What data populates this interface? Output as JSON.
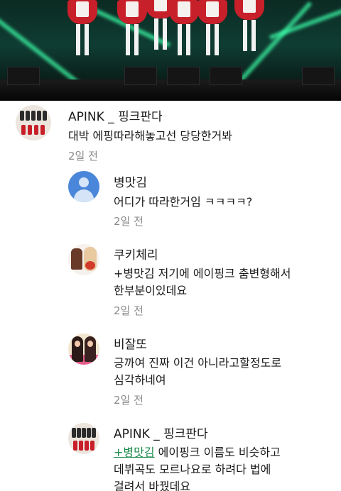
{
  "video": {
    "description_icon": "video-frame"
  },
  "comments": {
    "top": {
      "author": "APINK _ 핑크판다",
      "text": "대박 에핑따라해놓고선 당당한거봐",
      "time": "2일 전"
    },
    "replies": [
      {
        "author": "병맛김",
        "lines": [
          "어디가 따라한거임 ㅋㅋㅋㅋ?"
        ],
        "time": "2일 전"
      },
      {
        "author": "쿠키체리",
        "lines": [
          "+병맛김 저기에 에이핑크 춤변형해서",
          "한부분이있데요"
        ],
        "time": "2일 전"
      },
      {
        "author": "비잘또",
        "lines": [
          "긍까여 진짜 이건 아니라고할정도로",
          "심각하네여"
        ],
        "time": "2일 전"
      },
      {
        "author": "APINK _ 핑크판다",
        "mention": "+병맛김",
        "line1_rest": " 에이핑크 이름도 비슷하고",
        "lines_after": [
          "데뷔곡도 모르나요로 하려다 법에",
          "걸려서 바꿨데요"
        ]
      }
    ]
  },
  "colors": {
    "mention": "#1a8a4a",
    "time": "#8a8a8a",
    "default_avatar": "#4a86d9"
  }
}
